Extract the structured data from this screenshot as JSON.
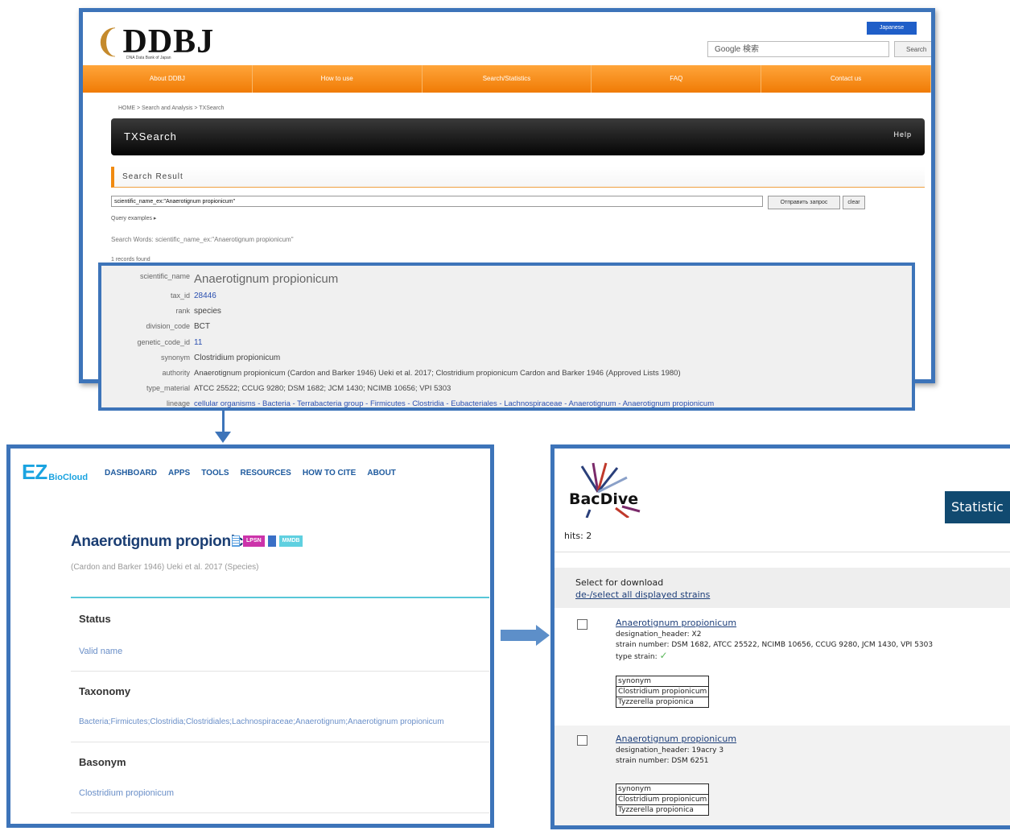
{
  "ddbj": {
    "logo_text": "DDBJ",
    "logo_subtitle": "DNA Data Bank of Japan",
    "lang_button": "Japanese",
    "google_search_placeholder": "Google 検索",
    "search_button": "Search",
    "nav": [
      "About DDBJ",
      "How to use",
      "Search/Statistics",
      "FAQ",
      "Contact us"
    ],
    "breadcrumb": "HOME > Search and Analysis > TXSearch",
    "tool_title": "TXSearch",
    "help_label": "Help",
    "section_title": "Search Result",
    "query_value": "scientific_name_ex:\"Anaerotignum propionicum\"",
    "submit_button": "Отправить запрос",
    "clear_button": "clear",
    "query_examples": "Query examples ▸",
    "search_words": "Search Words: scientific_name_ex:\"Anaerotignum propionicum\"",
    "records_found": "1 records found",
    "record": {
      "scientific_name_key": "scientific_name",
      "scientific_name": "Anaerotignum propionicum",
      "tax_id_key": "tax_id",
      "tax_id": "28446",
      "rank_key": "rank",
      "rank": "species",
      "division_code_key": "division_code",
      "division_code": "BCT",
      "genetic_code_id_key": "genetic_code_id",
      "genetic_code_id": "11",
      "synonym_key": "synonym",
      "synonym": "Clostridium propionicum",
      "authority_key": "authority",
      "authority": "Anaerotignum propionicum (Cardon and Barker 1946) Ueki et al. 2017; Clostridium propionicum Cardon and Barker 1946 (Approved Lists 1980)",
      "type_material_key": "type_material",
      "type_material": "ATCC 25522; CCUG 9280; DSM 1682; JCM 1430; NCIMB 10656; VPI 5303",
      "lineage_key": "lineage",
      "lineage": "cellular organisms - Bacteria - Terrabacteria group - Firmicutes - Clostridia - Eubacteriales - Lachnospiraceae - Anaerotignum - Anaerotignum propionicum"
    }
  },
  "ez": {
    "logo_ez": "EZ",
    "logo_bio": "BioCloud",
    "nav": [
      "DASHBOARD",
      "APPS",
      "TOOLS",
      "RESOURCES",
      "HOW TO CITE",
      "ABOUT"
    ],
    "title": "Anaerotignum propionicum",
    "badge_lpsn": "LPSN",
    "badge_mmdb": "MMDB",
    "authority": "(Cardon and Barker 1946) Ueki et al. 2017 (Species)",
    "status_label": "Status",
    "status_value": "Valid name",
    "taxonomy_label": "Taxonomy",
    "taxonomy_value": "Bacteria;Firmicutes;Clostridia;Clostridiales;Lachnospiraceae;Anaerotignum;Anaerotignum propionicum",
    "basonym_label": "Basonym",
    "basonym_value": "Clostridium propionicum"
  },
  "bacdive": {
    "logo_text": "BacDive",
    "statistics_tab": "Statistic",
    "hits": "hits: 2",
    "select_label": "Select for download",
    "select_all": "de-/select all displayed strains",
    "strains": [
      {
        "name": "Anaerotignum propionicum",
        "designation": "designation_header: X2",
        "strain_number": "strain number: DSM 1682, ATCC 25522, NCIMB 10656, CCUG 9280, JCM 1430, VPI 5303",
        "type_strain": "type strain:",
        "synonym_header": "synonym",
        "synonyms": [
          "Clostridium propionicum",
          "Tyzzerella propionica"
        ]
      },
      {
        "name": "Anaerotignum propionicum",
        "designation": "designation_header: 19acry 3",
        "strain_number": "strain number: DSM 6251",
        "synonym_header": "synonym",
        "synonyms": [
          "Clostridium propionicum",
          "Tyzzerella propionica"
        ]
      }
    ]
  },
  "colors": {
    "frame_blue": "#3d74b9",
    "ddbj_orange": "#f07b05",
    "ez_blue": "#1aa3e0",
    "ez_title": "#1b3e73",
    "bacdive_tab": "#114a70"
  },
  "icons": [
    "dna-helix-logo",
    "arrow-down",
    "arrow-right",
    "check-icon",
    "checkbox"
  ]
}
